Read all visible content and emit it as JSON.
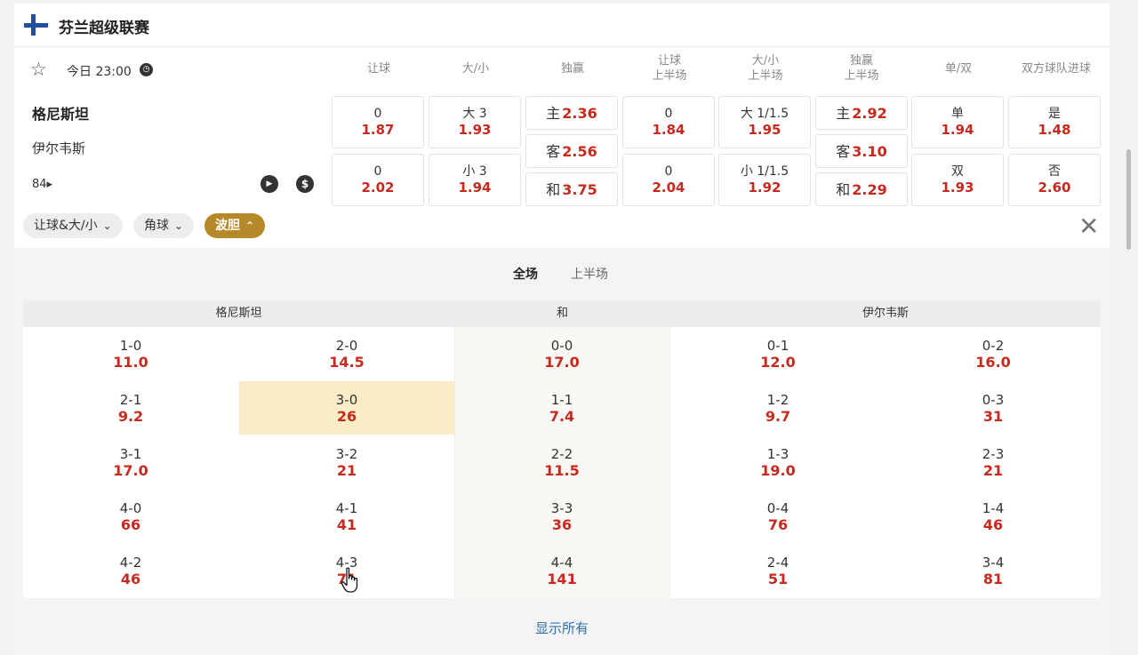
{
  "league": {
    "title": "芬兰超级联赛",
    "flag_icon": "finland-flag-icon"
  },
  "match": {
    "time": "今日 23:00",
    "home_team": "格尼斯坦",
    "away_team": "伊尔韦斯",
    "more_markets": "84",
    "more_arrow": "▸"
  },
  "columns": [
    {
      "line1": "让球",
      "line2": ""
    },
    {
      "line1": "大/小",
      "line2": ""
    },
    {
      "line1": "独赢",
      "line2": ""
    },
    {
      "line1": "让球",
      "line2": "上半场"
    },
    {
      "line1": "大/小",
      "line2": "上半场"
    },
    {
      "line1": "独赢",
      "line2": "上半场"
    },
    {
      "line1": "单/双",
      "line2": ""
    },
    {
      "line1": "双方球队进球",
      "line2": ""
    }
  ],
  "odds": {
    "handicap": [
      {
        "label": "0",
        "value": "1.87"
      },
      {
        "label": "0",
        "value": "2.02"
      }
    ],
    "overunder": [
      {
        "label": "大 3",
        "value": "1.93"
      },
      {
        "label": "小 3",
        "value": "1.94"
      }
    ],
    "moneyline": [
      {
        "label": "主",
        "value": "2.36"
      },
      {
        "label": "客",
        "value": "2.56"
      },
      {
        "label": "和",
        "value": "3.75"
      }
    ],
    "handicap_1h": [
      {
        "label": "0",
        "value": "1.84"
      },
      {
        "label": "0",
        "value": "2.04"
      }
    ],
    "overunder_1h": [
      {
        "label": "大 1/1.5",
        "value": "1.95"
      },
      {
        "label": "小 1/1.5",
        "value": "1.92"
      }
    ],
    "moneyline_1h": [
      {
        "label": "主",
        "value": "2.92"
      },
      {
        "label": "客",
        "value": "3.10"
      },
      {
        "label": "和",
        "value": "2.29"
      }
    ],
    "oddeven": [
      {
        "label": "单",
        "value": "1.94"
      },
      {
        "label": "双",
        "value": "1.93"
      }
    ],
    "btts": [
      {
        "label": "是",
        "value": "1.48"
      },
      {
        "label": "否",
        "value": "2.60"
      }
    ]
  },
  "filters": [
    {
      "label": "让球&大/小",
      "chev": "⌄"
    },
    {
      "label": "角球",
      "chev": "⌄"
    },
    {
      "label": "波胆",
      "chev": "⌃"
    }
  ],
  "close_glyph": "✕",
  "correct_score": {
    "tabs": [
      "全场",
      "上半场"
    ],
    "headers": {
      "home": "格尼斯坦",
      "draw": "和",
      "away": "伊尔韦斯"
    },
    "rows": [
      [
        {
          "score": "1-0",
          "odds": "11.0"
        },
        {
          "score": "2-0",
          "odds": "14.5"
        },
        {
          "score": "0-0",
          "odds": "17.0"
        },
        {
          "score": "0-1",
          "odds": "12.0"
        },
        {
          "score": "0-2",
          "odds": "16.0"
        }
      ],
      [
        {
          "score": "2-1",
          "odds": "9.2"
        },
        {
          "score": "3-0",
          "odds": "26"
        },
        {
          "score": "1-1",
          "odds": "7.4"
        },
        {
          "score": "1-2",
          "odds": "9.7"
        },
        {
          "score": "0-3",
          "odds": "31"
        }
      ],
      [
        {
          "score": "3-1",
          "odds": "17.0"
        },
        {
          "score": "3-2",
          "odds": "21"
        },
        {
          "score": "2-2",
          "odds": "11.5"
        },
        {
          "score": "1-3",
          "odds": "19.0"
        },
        {
          "score": "2-3",
          "odds": "21"
        }
      ],
      [
        {
          "score": "4-0",
          "odds": "66"
        },
        {
          "score": "4-1",
          "odds": "41"
        },
        {
          "score": "3-3",
          "odds": "36"
        },
        {
          "score": "0-4",
          "odds": "76"
        },
        {
          "score": "1-4",
          "odds": "46"
        }
      ],
      [
        {
          "score": "4-2",
          "odds": "46"
        },
        {
          "score": "4-3",
          "odds": "71"
        },
        {
          "score": "4-4",
          "odds": "141"
        },
        {
          "score": "2-4",
          "odds": "51"
        },
        {
          "score": "3-4",
          "odds": "81"
        }
      ]
    ],
    "show_all": "显示所有"
  },
  "colors": {
    "odds_red": "#c8291e",
    "accent_gold": "#b5882a",
    "link_blue": "#2f6fb3",
    "highlight": "#fbecc8",
    "flag_blue": "#1f4ea3"
  }
}
